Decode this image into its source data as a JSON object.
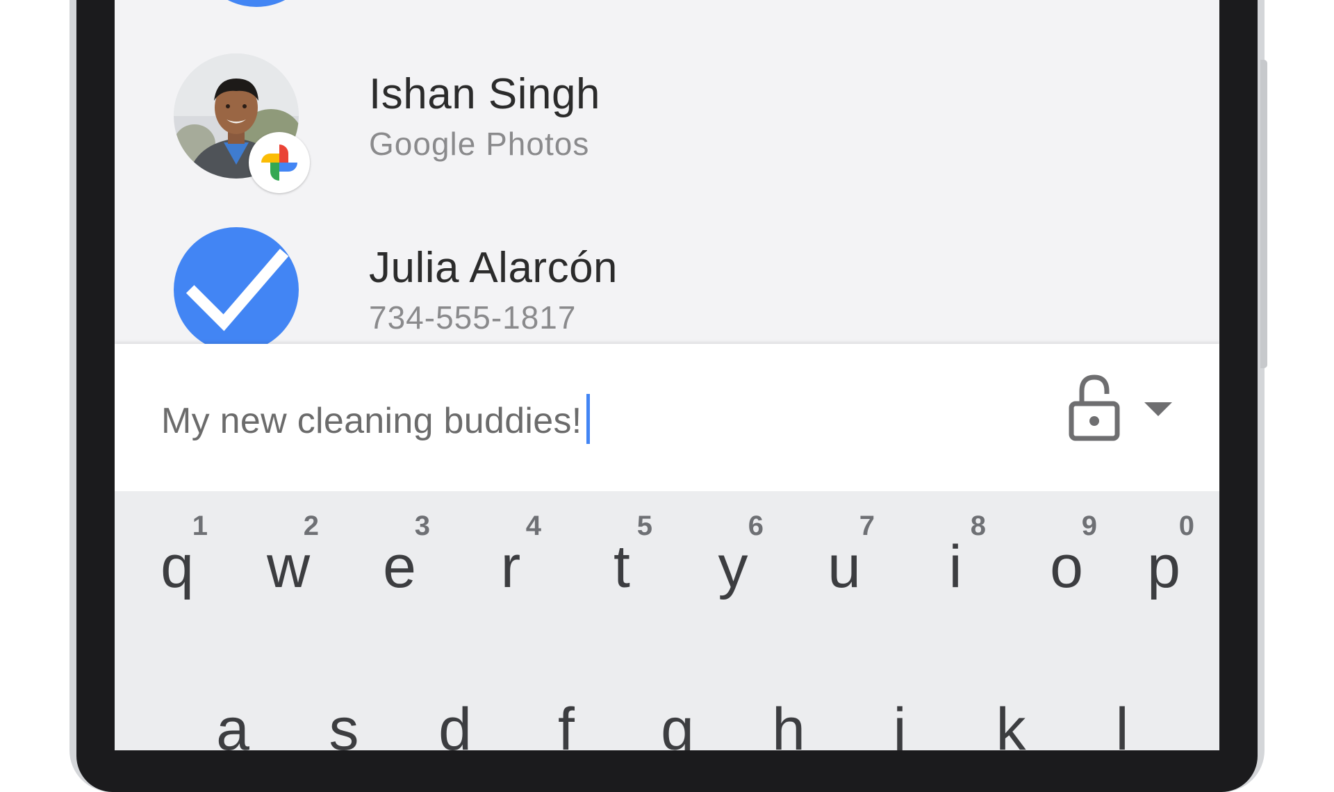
{
  "contacts": [
    {
      "name": "Ishan Singh",
      "subtitle": "Google Photos",
      "avatar": "photo",
      "badge_icon": "google-photos-icon"
    },
    {
      "name": "Julia Alarcón",
      "subtitle": "734-555-1817",
      "avatar": "checkmark",
      "selected": true
    }
  ],
  "composer": {
    "message": "My new cleaning buddies!",
    "privacy_icon": "unlocked-lock-icon",
    "dropdown_icon": "triangle-down-icon"
  },
  "keyboard": {
    "row1": [
      {
        "letter": "q",
        "hint": "1"
      },
      {
        "letter": "w",
        "hint": "2"
      },
      {
        "letter": "e",
        "hint": "3"
      },
      {
        "letter": "r",
        "hint": "4"
      },
      {
        "letter": "t",
        "hint": "5"
      },
      {
        "letter": "y",
        "hint": "6"
      },
      {
        "letter": "u",
        "hint": "7"
      },
      {
        "letter": "i",
        "hint": "8"
      },
      {
        "letter": "o",
        "hint": "9"
      },
      {
        "letter": "p",
        "hint": "0"
      }
    ],
    "row2": [
      "a",
      "s",
      "d",
      "f",
      "g",
      "h",
      "j",
      "k",
      "l"
    ]
  },
  "colors": {
    "accent": "#4285f4",
    "screen_background": "#f3f3f5",
    "keyboard_background": "#ecedef",
    "bezel": "#1b1b1d"
  }
}
